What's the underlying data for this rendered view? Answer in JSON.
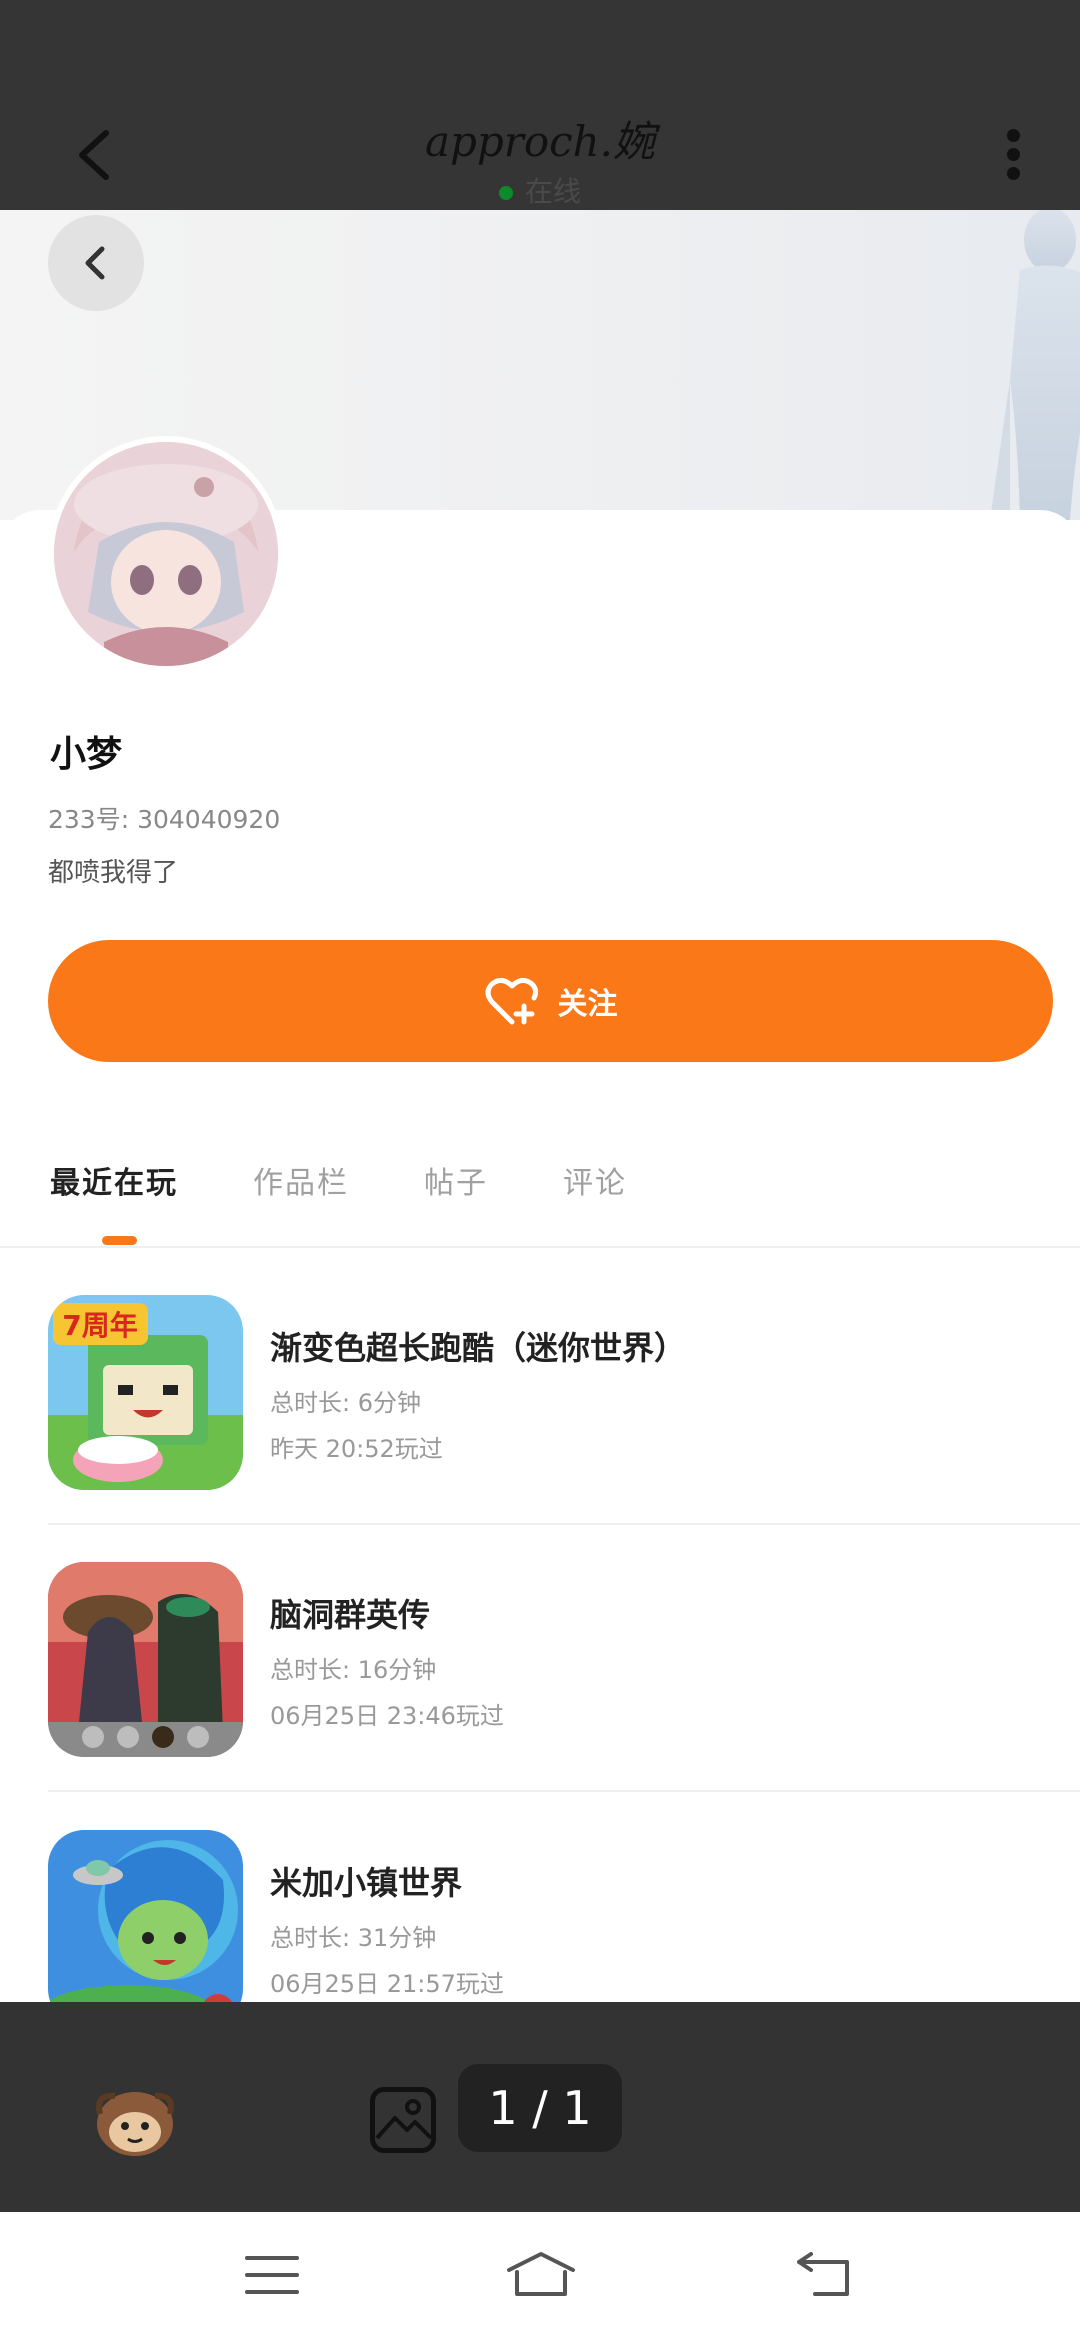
{
  "header": {
    "title": "approch.婉",
    "status": "在线",
    "back_icon": "chevron-left-icon",
    "more_icon": "more-vertical-icon"
  },
  "profile": {
    "name": "小梦",
    "uid": "233号: 304040920",
    "bio": "都喷我得了",
    "follow_label": "关注"
  },
  "tabs": [
    {
      "label": "最近在玩",
      "active": true
    },
    {
      "label": "作品栏",
      "active": false
    },
    {
      "label": "帖子",
      "active": false
    },
    {
      "label": "评论",
      "active": false
    }
  ],
  "games": [
    {
      "title": "渐变色超长跑酷（迷你世界）",
      "duration": "总时长: 6分钟",
      "last_played": "昨天 20:52玩过",
      "icon_badge": "7周年"
    },
    {
      "title": "脑洞群英传",
      "duration": "总时长: 16分钟",
      "last_played": "06月25日 23:46玩过"
    },
    {
      "title": "米加小镇世界",
      "duration": "总时长: 31分钟",
      "last_played": "06月25日 21:57玩过"
    }
  ],
  "viewer": {
    "counter": "1 / 1",
    "gallery_icon": "image-icon"
  },
  "colors": {
    "accent": "#fb7818",
    "topbar": "#353535",
    "online": "#0f8a2a"
  }
}
